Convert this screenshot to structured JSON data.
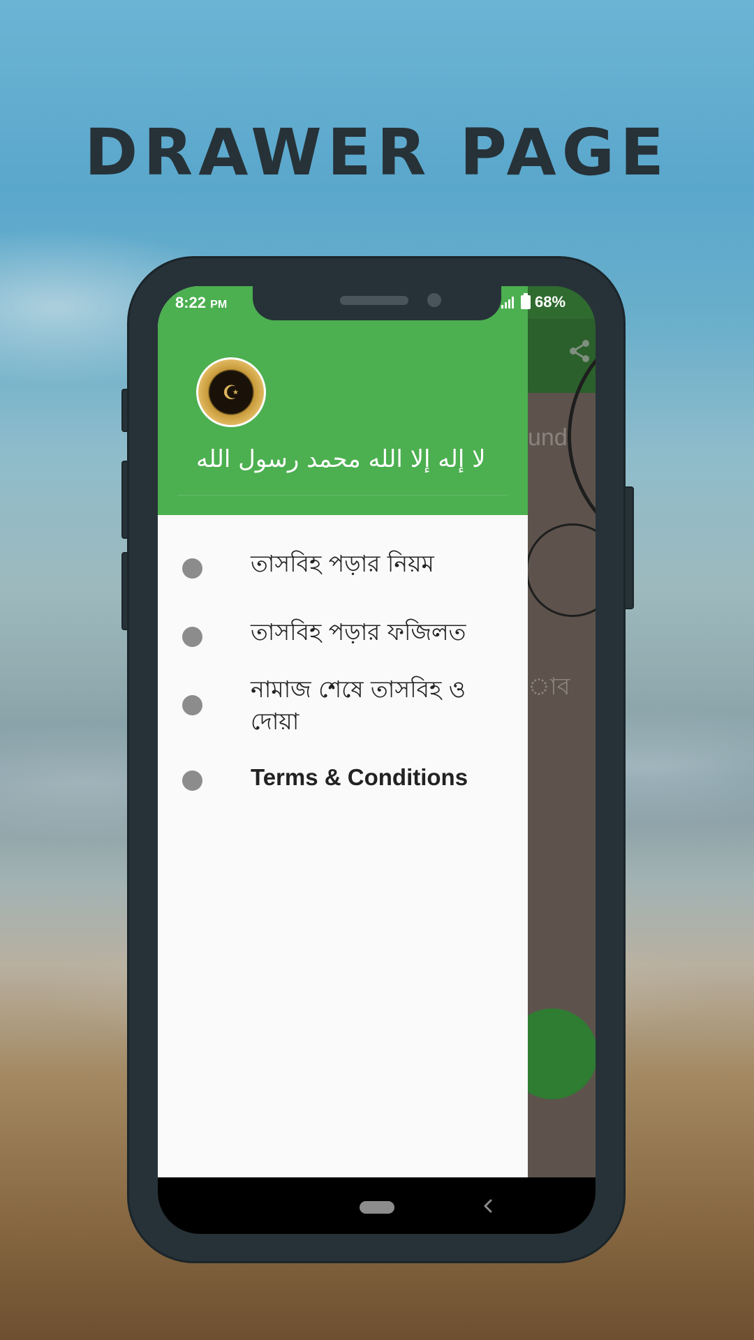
{
  "page_title": "DRAWER PAGE",
  "status_bar": {
    "time": "8:22",
    "ampm": "PM",
    "battery": "68%"
  },
  "drawer": {
    "header_text": "لا إله إلا الله محمد رسول الله",
    "items": [
      {
        "label": "তাসবিহ পড়ার নিয়ম"
      },
      {
        "label": "তাসবিহ পড়ার ফজিলত"
      },
      {
        "label": "নামাজ শেষে তাসবিহ ও দোয়া"
      },
      {
        "label": "Terms & Conditions"
      }
    ]
  },
  "background_app": {
    "partial_text_1": "und",
    "partial_text_2": "াব"
  },
  "colors": {
    "drawer_header": "#4caf50",
    "title": "#263238",
    "phone_body": "#263238",
    "bullet": "#8c8c8c"
  },
  "icons": {
    "share": "share-icon",
    "back": "back-chevron-icon",
    "home": "home-pill-icon",
    "signal": "signal-icon",
    "battery": "battery-icon"
  }
}
